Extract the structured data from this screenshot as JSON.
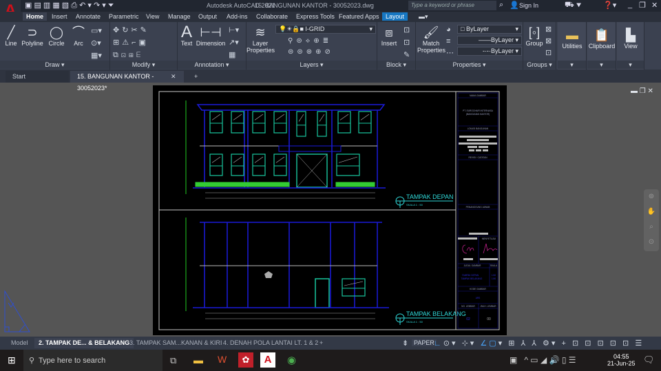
{
  "app": {
    "title": "Autodesk AutoCAD 2021",
    "file": "15. BANGUNAN KANTOR - 30052023.dwg",
    "logo": "A"
  },
  "search": {
    "placeholder": "Type a keyword or phrase"
  },
  "user": {
    "sign_in": "Sign In"
  },
  "ribbon_tabs": [
    "Home",
    "Insert",
    "Annotate",
    "Parametric",
    "View",
    "Manage",
    "Output",
    "Add-ins",
    "Collaborate",
    "Express Tools",
    "Featured Apps",
    "Layout"
  ],
  "panels": {
    "draw": {
      "label": "Draw",
      "tools": [
        "Line",
        "Polyline",
        "Circle",
        "Arc"
      ]
    },
    "modify": {
      "label": "Modify"
    },
    "annotation": {
      "label": "Annotation",
      "tools": [
        "Text",
        "Dimension"
      ]
    },
    "layers": {
      "label": "Layers",
      "tool": "Layer Properties",
      "current_layer": "I-GRID"
    },
    "block": {
      "label": "Block",
      "tool": "Insert"
    },
    "properties": {
      "label": "Properties",
      "tool": "Match Properties",
      "color": "ByLayer",
      "linetype": "ByLayer",
      "lineweight": "ByLayer"
    },
    "groups": {
      "label": "Groups",
      "tool": "Group"
    },
    "utilities": {
      "label": "Utilities"
    },
    "clipboard": {
      "label": "Clipboard"
    },
    "view": {
      "label": "View"
    }
  },
  "doc_tabs": [
    "Start",
    "15. BANGUNAN KANTOR - 30052023*"
  ],
  "drawing": {
    "front_title": "TAMPAK DEPAN",
    "front_scale": "SKALA 1 : 50",
    "back_title": "TAMPAK BELAKANG",
    "back_scale": "SKALA 1 : 50",
    "title_block": {
      "nama_gambar": "NAMA GAMBAR",
      "project": "PT. EUROCHAIR INTERNASA",
      "project_sub": "(BANGUNAN KANTOR)",
      "lokasi": "LOKASI BANGUNAN",
      "revisi": "REVISI / CATATAN",
      "penanggung": "PENANGGUNG JAWAB",
      "menyetujui": "MENYETUJUI",
      "judul": "JUDUL GAMBAR",
      "skala": "SKALA",
      "judul_1": "TAMPAK DEPAN",
      "judul_2": "TAMPAK BELAKANG",
      "skala_1": "1:50",
      "skala_2": "1:50",
      "kode": "KODE GAMBAR",
      "kode_val": "ARS",
      "no_lembar": "NO. LEMBAR",
      "jml_lembar": "JMLH. LEMBAR",
      "no_val": "02",
      "jml_val": "00"
    }
  },
  "layout_tabs": [
    "Model",
    "2. TAMPAK DE... & BELAKANG",
    "3. TAMPAK SAM...KANAN & KIRI",
    "4. DENAH POLA LANTAI LT. 1 & 2"
  ],
  "status": {
    "space": "PAPER"
  },
  "taskbar": {
    "search_placeholder": "Type here to search",
    "time": "04:55",
    "date": "21-Jun-25"
  },
  "colors": {
    "accent": "#1777c2",
    "canvas": "#555555",
    "paper": "#000000",
    "building": "#1a1adc",
    "window": "#19c7a0",
    "text_cyan": "#2fd8d8"
  }
}
